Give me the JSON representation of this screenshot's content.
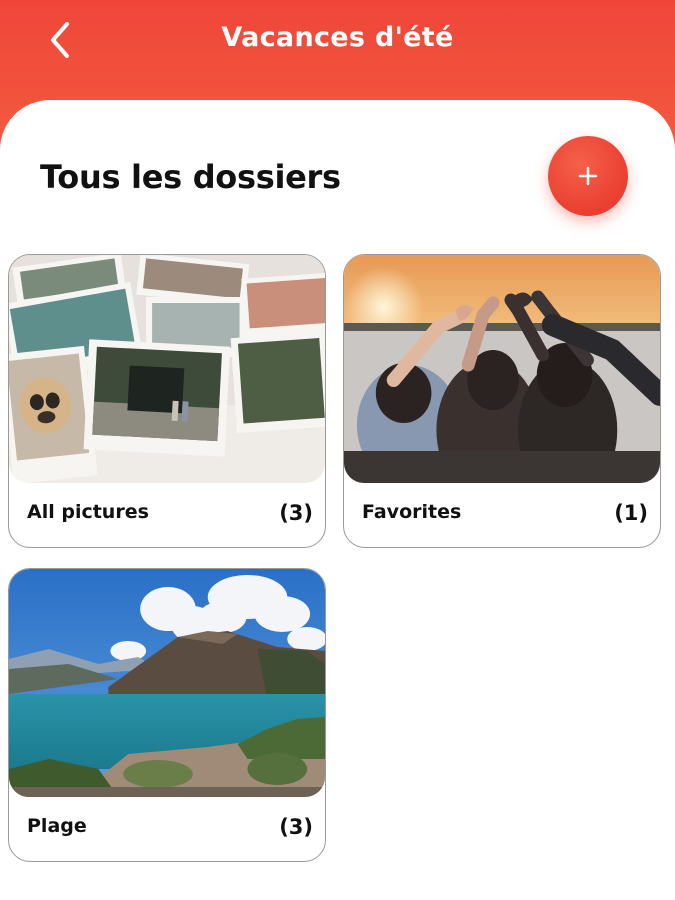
{
  "header": {
    "title": "Vacances d'été",
    "back_icon": "chevron-left-icon",
    "color": "#f0463a"
  },
  "main": {
    "section_title": "Tous les dossiers",
    "add_button_icon": "plus-icon",
    "add_button_label": "+"
  },
  "folders": [
    {
      "label": "All pictures",
      "count": "(3)",
      "thumbnail": "scattered-photos"
    },
    {
      "label": "Favorites",
      "count": "(1)",
      "thumbnail": "friends-heart-sunset"
    },
    {
      "label": "Plage",
      "count": "(3)",
      "thumbnail": "mountain-lake"
    }
  ]
}
